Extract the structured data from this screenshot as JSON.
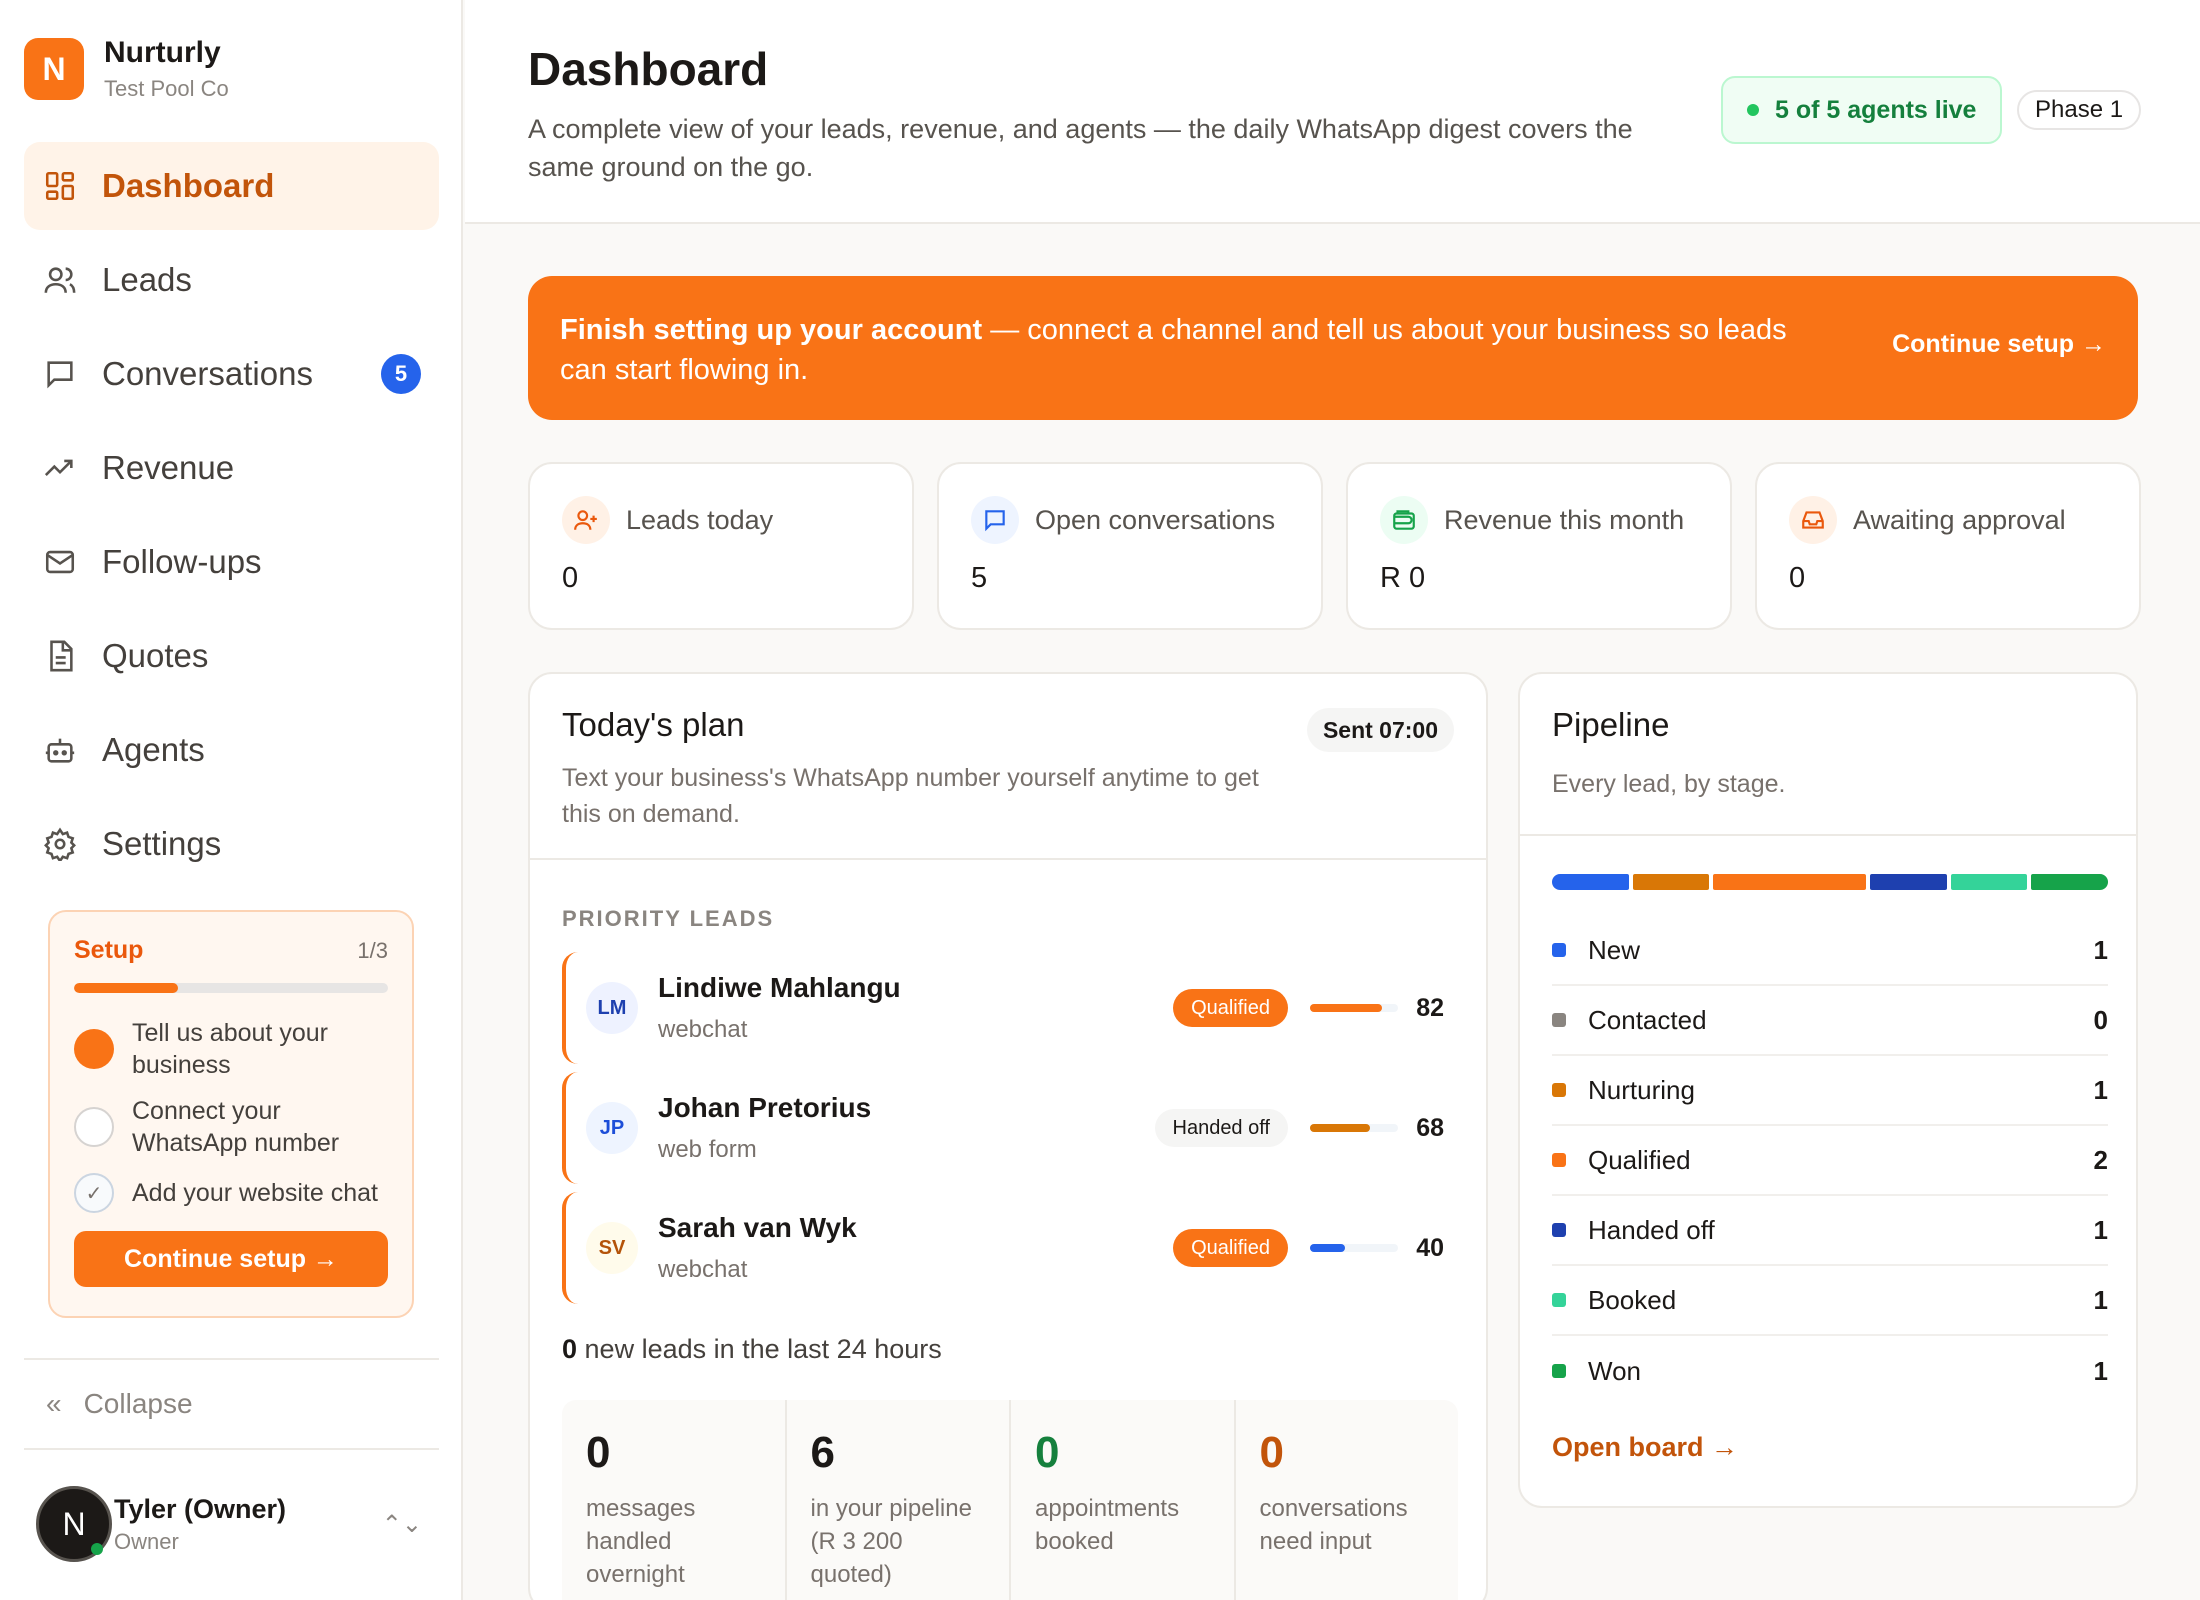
{
  "brand": {
    "logo_letter": "N",
    "name": "Nurturly",
    "org": "Test Pool Co"
  },
  "nav": [
    {
      "label": "Dashboard",
      "icon": "dashboard-icon",
      "active": true
    },
    {
      "label": "Leads",
      "icon": "users-icon"
    },
    {
      "label": "Conversations",
      "icon": "chat-icon",
      "badge": "5"
    },
    {
      "label": "Revenue",
      "icon": "trend-icon"
    },
    {
      "label": "Follow-ups",
      "icon": "mail-icon"
    },
    {
      "label": "Quotes",
      "icon": "document-icon"
    },
    {
      "label": "Agents",
      "icon": "bot-icon"
    },
    {
      "label": "Settings",
      "icon": "gear-icon"
    }
  ],
  "setup": {
    "title": "Setup",
    "count": "1/3",
    "progress_fraction": 0.33,
    "steps": [
      {
        "label": "Tell us about your business",
        "state": "current"
      },
      {
        "label": "Connect your WhatsApp number",
        "state": "todo"
      },
      {
        "label": "Add your website chat",
        "state": "done",
        "mark": "✓"
      }
    ],
    "button": "Continue setup →"
  },
  "collapse": {
    "icon": "«",
    "label": "Collapse"
  },
  "user": {
    "initial": "N",
    "name": "Tyler (Owner)",
    "role": "Owner",
    "switch_icon": "⌃⌄"
  },
  "header": {
    "title": "Dashboard",
    "description": "A complete view of your leads, revenue, and agents — the daily WhatsApp digest covers the same ground on the go.",
    "live_pill": "5 of 5 agents live",
    "phase_pill": "Phase 1"
  },
  "banner": {
    "bold": "Finish setting up your account",
    "text": " — connect a channel and tell us about your business so leads can start flowing in.",
    "cta": "Continue setup →"
  },
  "stats": [
    {
      "label": "Leads today",
      "value": "0",
      "icon": "user-plus-icon",
      "tint": "#fff1e6",
      "color": "#ea580c"
    },
    {
      "label": "Open conversations",
      "value": "5",
      "icon": "chat-icon",
      "tint": "#eef4ff",
      "color": "#2563eb"
    },
    {
      "label": "Revenue this month",
      "value": "R 0",
      "icon": "wallet-icon",
      "tint": "#ecfdf3",
      "color": "#16a34a"
    },
    {
      "label": "Awaiting approval",
      "value": "0",
      "icon": "inbox-icon",
      "tint": "#fff1e6",
      "color": "#ea580c"
    }
  ],
  "plan": {
    "title": "Today's plan",
    "sent": "Sent 07:00",
    "subtitle": "Text your business's WhatsApp number yourself anytime to get this on demand.",
    "section_label": "PRIORITY LEADS",
    "leads": [
      {
        "initials": "LM",
        "name": "Lindiwe Mahlangu",
        "source": "webchat",
        "status": "Qualified",
        "status_type": "qualified",
        "score": 82,
        "bar_color": "#f97316",
        "avatar_bg": "#eef2ff",
        "avatar_fg": "#1e40af"
      },
      {
        "initials": "JP",
        "name": "Johan Pretorius",
        "source": "web form",
        "status": "Handed off",
        "status_type": "handed",
        "score": 68,
        "bar_color": "#d97706",
        "avatar_bg": "#eef4ff",
        "avatar_fg": "#1d4ed8"
      },
      {
        "initials": "SV",
        "name": "Sarah van Wyk",
        "source": "webchat",
        "status": "Qualified",
        "status_type": "qualified",
        "score": 40,
        "bar_color": "#2563eb",
        "avatar_bg": "#fffbeb",
        "avatar_fg": "#b45309"
      }
    ],
    "new_leads_count": "0",
    "new_leads_text": " new leads in the last 24 hours",
    "metrics": [
      {
        "value": "0",
        "label": "messages handled overnight",
        "color": "#1c1917"
      },
      {
        "value": "6",
        "label": "in your pipeline (R 3 200 quoted)",
        "color": "#1c1917"
      },
      {
        "value": "0",
        "label": "appointments booked",
        "color": "#15803d"
      },
      {
        "value": "0",
        "label": "conversations need input",
        "color": "#c2540a"
      }
    ]
  },
  "pipeline": {
    "title": "Pipeline",
    "subtitle": "Every lead, by stage.",
    "stages": [
      {
        "name": "New",
        "count": 1,
        "color": "#2563eb"
      },
      {
        "name": "Contacted",
        "count": 0,
        "color": "#8a8580"
      },
      {
        "name": "Nurturing",
        "count": 1,
        "color": "#d97706"
      },
      {
        "name": "Qualified",
        "count": 2,
        "color": "#f97316"
      },
      {
        "name": "Handed off",
        "count": 1,
        "color": "#1e40af"
      },
      {
        "name": "Booked",
        "count": 1,
        "color": "#34d399"
      },
      {
        "name": "Won",
        "count": 1,
        "color": "#16a34a"
      }
    ],
    "open_board": "Open board →"
  }
}
